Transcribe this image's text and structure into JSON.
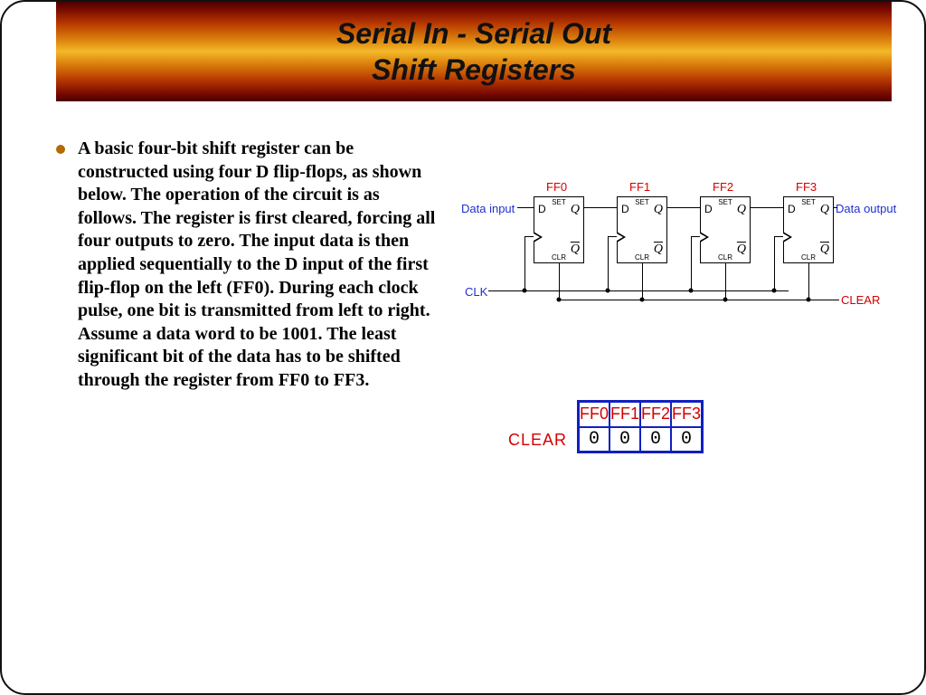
{
  "title_line1": "Serial In - Serial Out",
  "title_line2": "Shift Registers",
  "bullet": "A basic four-bit shift register can be constructed using four D flip-flops, as shown below.  The operation of the circuit is as follows.  The register is first cleared, forcing all four outputs to zero.  The input data is then applied sequentially to the D input of the first flip-flop on the left (FF0).  During each clock pulse, one bit is transmitted from left to right.  Assume a data word to be 1001.  The least significant bit of the data has to be shifted through the register from FF0 to FF3.",
  "circuit": {
    "data_input": "Data input",
    "data_output": "Data output",
    "clk": "CLK",
    "clear": "CLEAR",
    "ff_labels": [
      "FF0",
      "FF1",
      "FF2",
      "FF3"
    ],
    "pin_d": "D",
    "pin_q": "Q",
    "pin_qb": "Q",
    "pin_set": "SET",
    "pin_clr": "CLR"
  },
  "table": {
    "side_label": "CLEAR",
    "headers": [
      "FF0",
      "FF1",
      "FF2",
      "FF3"
    ],
    "values": [
      "0",
      "0",
      "0",
      "0"
    ]
  }
}
